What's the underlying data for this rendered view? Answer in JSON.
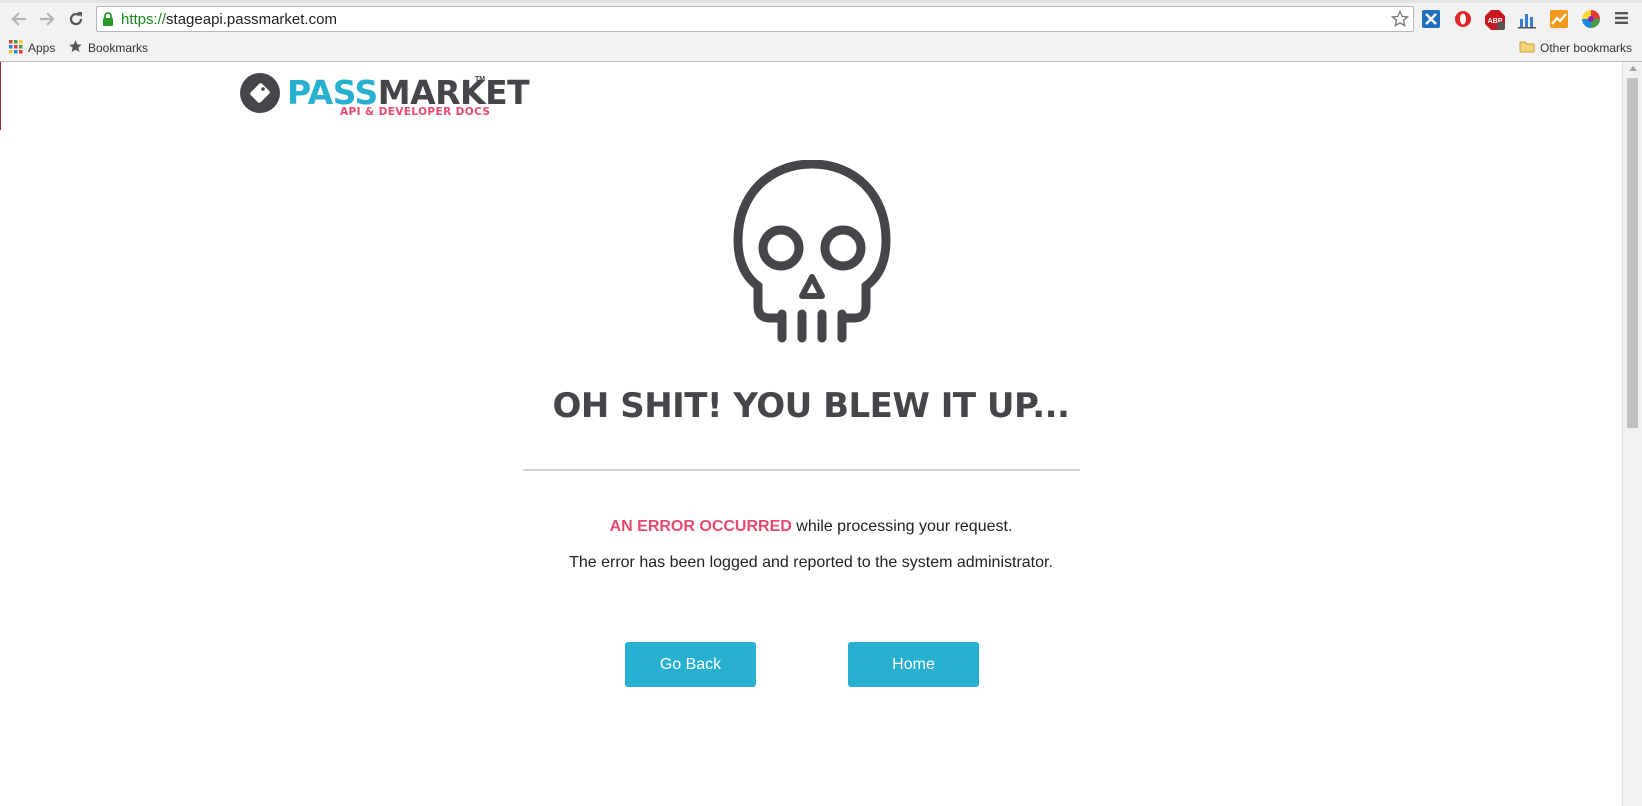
{
  "browser": {
    "url_scheme": "https://",
    "url_host": "stageapi.passmarket.com",
    "bookmarks": {
      "apps_label": "Apps",
      "bookmarks_label": "Bookmarks",
      "other_label": "Other bookmarks"
    },
    "extensions": [
      "extension-blue-icon",
      "opera-icon",
      "adblock-icon",
      "chart-icon",
      "trend-icon",
      "color-wheel-icon"
    ]
  },
  "logo": {
    "pass": "PASS",
    "market": "MARKET",
    "tm": "TM",
    "subtitle": "API & DEVELOPER DOCS"
  },
  "error": {
    "headline": "OH SHIT! YOU BLEW IT UP...",
    "highlight": "AN ERROR OCCURRED",
    "line1_rest": " while processing your request.",
    "line2": "The error has been logged and reported to the system administrator."
  },
  "buttons": {
    "go_back": "Go Back",
    "home": "Home"
  },
  "colors": {
    "accent": "#27b0d0",
    "error": "#e84a6f",
    "dark": "#444649"
  }
}
